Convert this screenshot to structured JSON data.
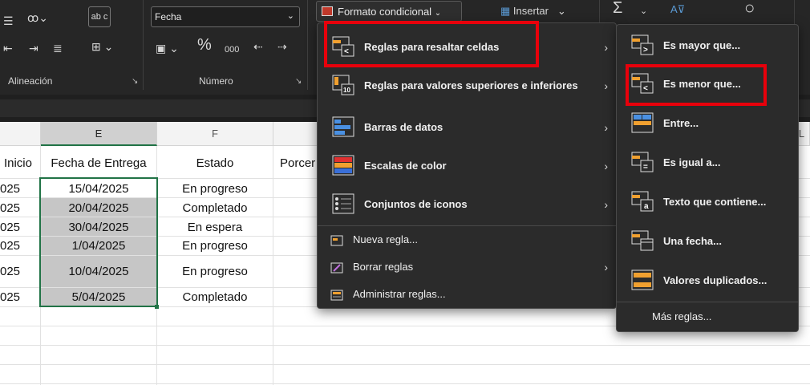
{
  "ribbon": {
    "groups": {
      "alignment": "Alineación",
      "number": "Número"
    },
    "number_format": "Fecha",
    "percent": "%",
    "thousands": "000",
    "wrap_icon": "ab c",
    "conditional_format": "Formato condicional",
    "insert": "Insertar",
    "sum": "Σ"
  },
  "columns": {
    "e": "E",
    "f": "F",
    "l": "L"
  },
  "table": {
    "headers": {
      "start": "Inicio",
      "delivery": "Fecha de Entrega",
      "status": "Estado",
      "percent": "Porcer"
    },
    "rows": [
      {
        "start": "025",
        "delivery": "15/04/2025",
        "status": "En progreso"
      },
      {
        "start": "025",
        "delivery": "20/04/2025",
        "status": "Completado"
      },
      {
        "start": "025",
        "delivery": "30/04/2025",
        "status": "En espera"
      },
      {
        "start": "025",
        "delivery": "1/04/2025",
        "status": "En progreso"
      },
      {
        "start": "025",
        "delivery": "10/04/2025",
        "status": "En progreso"
      },
      {
        "start": "025",
        "delivery": "5/04/2025",
        "status": "Completado"
      }
    ]
  },
  "cf_menu": {
    "items": [
      {
        "label": "Reglas para resaltar celdas",
        "icon": "highlight-rules-icon"
      },
      {
        "label": "Reglas para valores superiores e inferiores",
        "icon": "top-bottom-icon"
      },
      {
        "label": "Barras de datos",
        "icon": "data-bars-icon"
      },
      {
        "label": "Escalas de color",
        "icon": "color-scales-icon"
      },
      {
        "label": "Conjuntos de iconos",
        "icon": "icon-sets-icon"
      }
    ],
    "small_items": [
      {
        "label": "Nueva regla...",
        "icon": "new-rule-icon"
      },
      {
        "label": "Borrar reglas",
        "icon": "clear-rules-icon"
      },
      {
        "label": "Administrar reglas...",
        "icon": "manage-rules-icon"
      }
    ]
  },
  "submenu": {
    "items": [
      {
        "label": "Es mayor que...",
        "icon": "greater-than-icon"
      },
      {
        "label": "Es menor que...",
        "icon": "less-than-icon"
      },
      {
        "label": "Entre...",
        "icon": "between-icon"
      },
      {
        "label": "Es igual a...",
        "icon": "equal-to-icon"
      },
      {
        "label": "Texto que contiene...",
        "icon": "text-contains-icon"
      },
      {
        "label": "Una fecha...",
        "icon": "date-occurring-icon"
      },
      {
        "label": "Valores duplicados...",
        "icon": "duplicate-values-icon"
      }
    ],
    "more": "Más reglas..."
  },
  "colors": {
    "highlight": "#e8000b",
    "selection": "#217346",
    "ribbon": "#262626",
    "menu": "#2b2b2b"
  }
}
